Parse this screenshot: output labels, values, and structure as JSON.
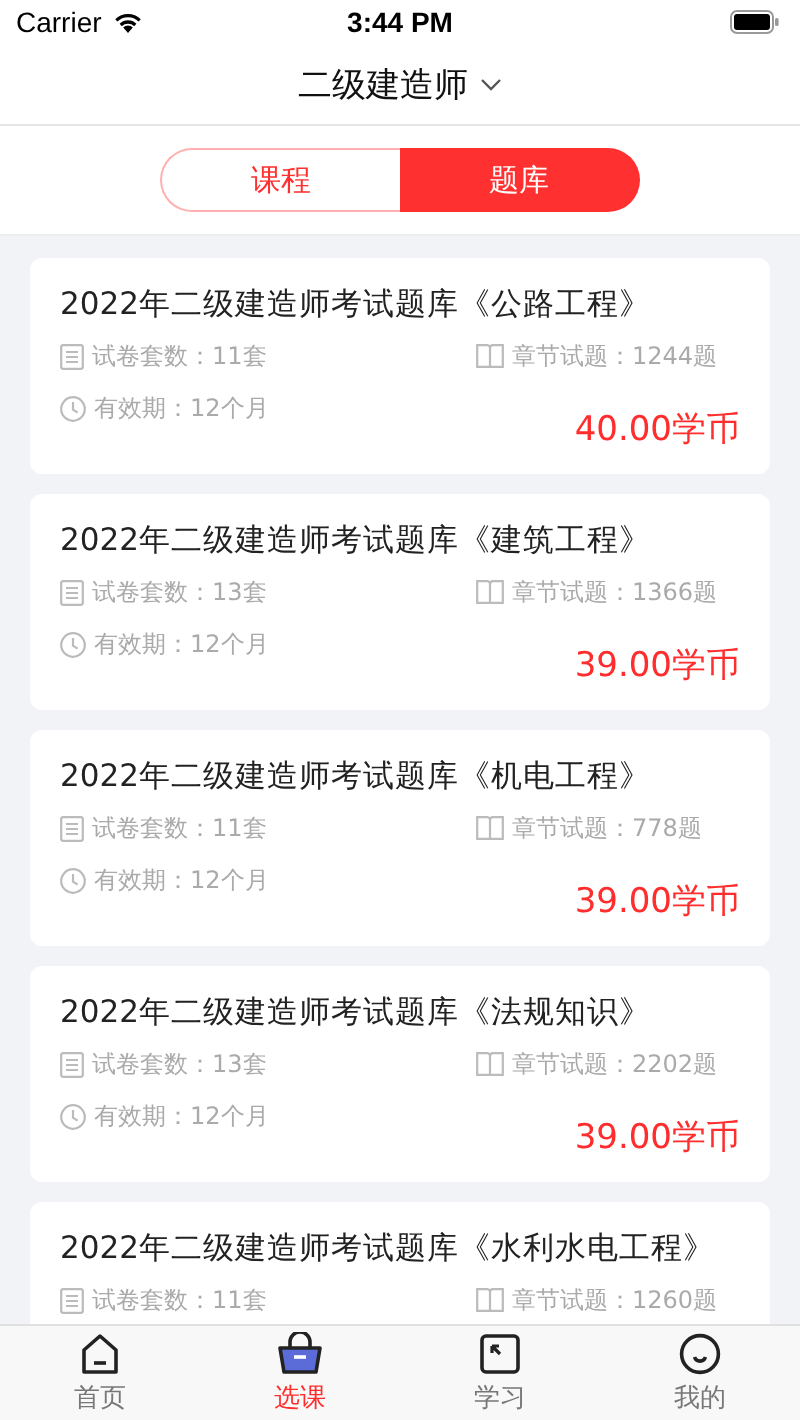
{
  "status_bar": {
    "carrier": "Carrier",
    "time": "3:44 PM"
  },
  "nav": {
    "title": "二级建造师"
  },
  "segments": [
    {
      "label": "课程",
      "selected": false
    },
    {
      "label": "题库",
      "selected": true
    }
  ],
  "cards": [
    {
      "title": "2022年二级建造师考试题库《公路工程》",
      "paper_count": "试卷套数：11套",
      "chapter_questions": "章节试题：1244题",
      "validity": "有效期：12个月",
      "price": "40.00学币"
    },
    {
      "title": "2022年二级建造师考试题库《建筑工程》",
      "paper_count": "试卷套数：13套",
      "chapter_questions": "章节试题：1366题",
      "validity": "有效期：12个月",
      "price": "39.00学币"
    },
    {
      "title": "2022年二级建造师考试题库《机电工程》",
      "paper_count": "试卷套数：11套",
      "chapter_questions": "章节试题：778题",
      "validity": "有效期：12个月",
      "price": "39.00学币"
    },
    {
      "title": "2022年二级建造师考试题库《法规知识》",
      "paper_count": "试卷套数：13套",
      "chapter_questions": "章节试题：2202题",
      "validity": "有效期：12个月",
      "price": "39.00学币"
    },
    {
      "title": "2022年二级建造师考试题库《水利水电工程》",
      "paper_count": "试卷套数：11套",
      "chapter_questions": "章节试题：1260题"
    }
  ],
  "tab_bar": [
    {
      "kind": "home",
      "label": "首页",
      "selected": false
    },
    {
      "kind": "basket",
      "label": "选课",
      "selected": true
    },
    {
      "kind": "study",
      "label": "学习",
      "selected": false
    },
    {
      "kind": "profile",
      "label": "我的",
      "selected": false
    }
  ]
}
